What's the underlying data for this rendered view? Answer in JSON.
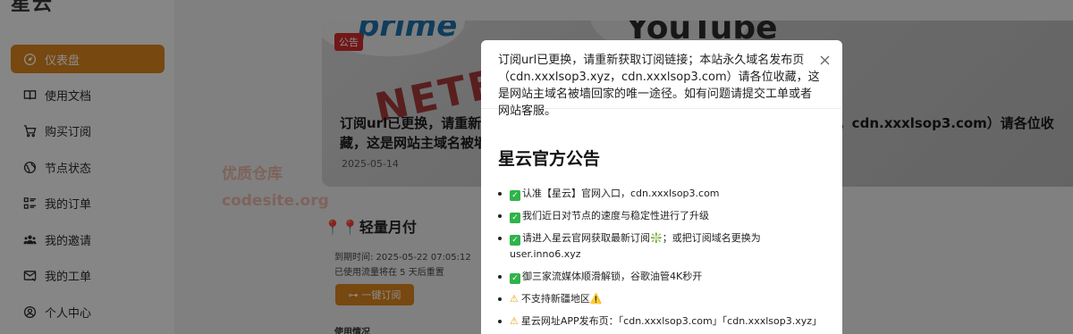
{
  "sidebar": {
    "brand": "星云",
    "items": [
      {
        "label": "仪表盘",
        "icon": "dashboard-icon",
        "active": true
      },
      {
        "label": "使用文档",
        "icon": "book-icon",
        "active": false
      },
      {
        "label": "购买订阅",
        "icon": "cart-icon",
        "active": false
      },
      {
        "label": "节点状态",
        "icon": "globe-icon",
        "active": false
      },
      {
        "label": "我的订单",
        "icon": "list-icon",
        "active": false
      },
      {
        "label": "我的邀请",
        "icon": "users-icon",
        "active": false
      },
      {
        "label": "我的工单",
        "icon": "ticket-icon",
        "active": false
      },
      {
        "label": "个人中心",
        "icon": "user-circle-icon",
        "active": false
      }
    ]
  },
  "banner": {
    "tag": "公告",
    "title": "订阅url已更换，请重新获取订阅链接；本站永久域名发布页（cdn.xxxlsop3.xyz，cdn.xxxlsop3.com）请各位收藏，这是网站主域名被墙回家的唯一途径。如有问题请提交工单或者网站客服。",
    "date": "2025-05-14",
    "brand_texts": [
      "NETFLIX",
      "YouTube",
      "prime"
    ]
  },
  "watermark": {
    "line1": "优质仓库",
    "line2": "codesite.org"
  },
  "plan": {
    "title": "轻量月付",
    "expire": "到期时间: 2025-05-22 07:05:12",
    "reset": "已使用流量将在 5 天后重置",
    "subscribe_button": "一键订阅",
    "usage_label": "使用情况"
  },
  "modal": {
    "header_text": "订阅url已更换，请重新获取订阅链接；本站永久域名发布页（cdn.xxxlsop3.xyz，cdn.xxxlsop3.com）请各位收藏，这是网站主域名被墙回家的唯一途径。如有问题请提交工单或者网站客服。",
    "announce_title": "星云官方公告",
    "items": [
      {
        "mark": "check",
        "text": "认准【星云】官网入口，cdn.xxxlsop3.com"
      },
      {
        "mark": "check",
        "text": "我们近日对节点的速度与稳定性进行了升级"
      },
      {
        "mark": "check",
        "text": "请进入星云官网获取最新订阅❇️；或把订阅域名更换为 user.inno6.xyz"
      },
      {
        "mark": "check",
        "text": "御三家流媒体顺滑解锁，谷歌油管4K秒开"
      },
      {
        "mark": "warn",
        "text": "不支持新疆地区⚠️"
      },
      {
        "mark": "warn",
        "text": "星云网址APP发布页：「cdn.xxxlsop3.com」「cdn.xxxlsop3.xyz」"
      }
    ]
  },
  "colors": {
    "accent": "#d9831e",
    "tag_red": "#d02a2a",
    "check_green": "#2fb34a"
  }
}
